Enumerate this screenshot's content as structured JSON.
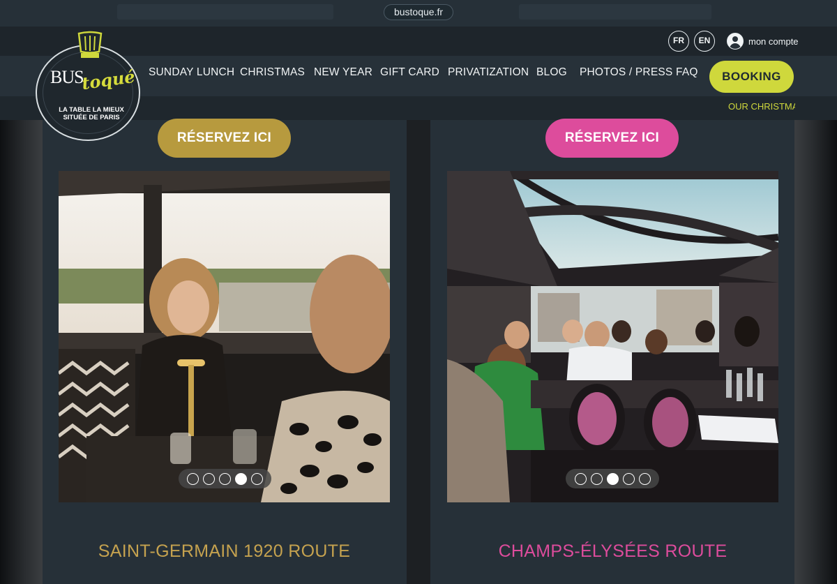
{
  "browser": {
    "url": "bustoque.fr"
  },
  "header": {
    "languages": [
      "FR",
      "EN"
    ],
    "account_label": "mon compte",
    "logo": {
      "brand_bus": "BUS",
      "brand_toque": "toqué",
      "tagline_line1": "LA TABLE LA MIEUX",
      "tagline_line2": "SITUÉE DE PARIS"
    },
    "nav": [
      "SUNDAY LUNCH",
      "CHRISTMAS",
      "NEW YEAR",
      "GIFT CARD",
      "PRIVATIZATION",
      "BLOG",
      "PHOTOS / PRESS",
      "FAQ"
    ],
    "booking_label": "BOOKING",
    "marquee": "OUR CHRISTMA"
  },
  "cards": [
    {
      "button": "RÉSERVEZ ICI",
      "title": "SAINT-GERMAIN 1920 ROUTE",
      "slides": 5,
      "active_slide": 4,
      "accent": "#b79a3e"
    },
    {
      "button": "RÉSERVEZ ICI",
      "title": "CHAMPS-ÉLYSÉES ROUTE",
      "slides": 5,
      "active_slide": 3,
      "accent": "#dd4c9c"
    }
  ],
  "colors": {
    "lime": "#cfd83c",
    "gold": "#b79a3e",
    "pink": "#dd4c9c",
    "panel": "#263038"
  }
}
